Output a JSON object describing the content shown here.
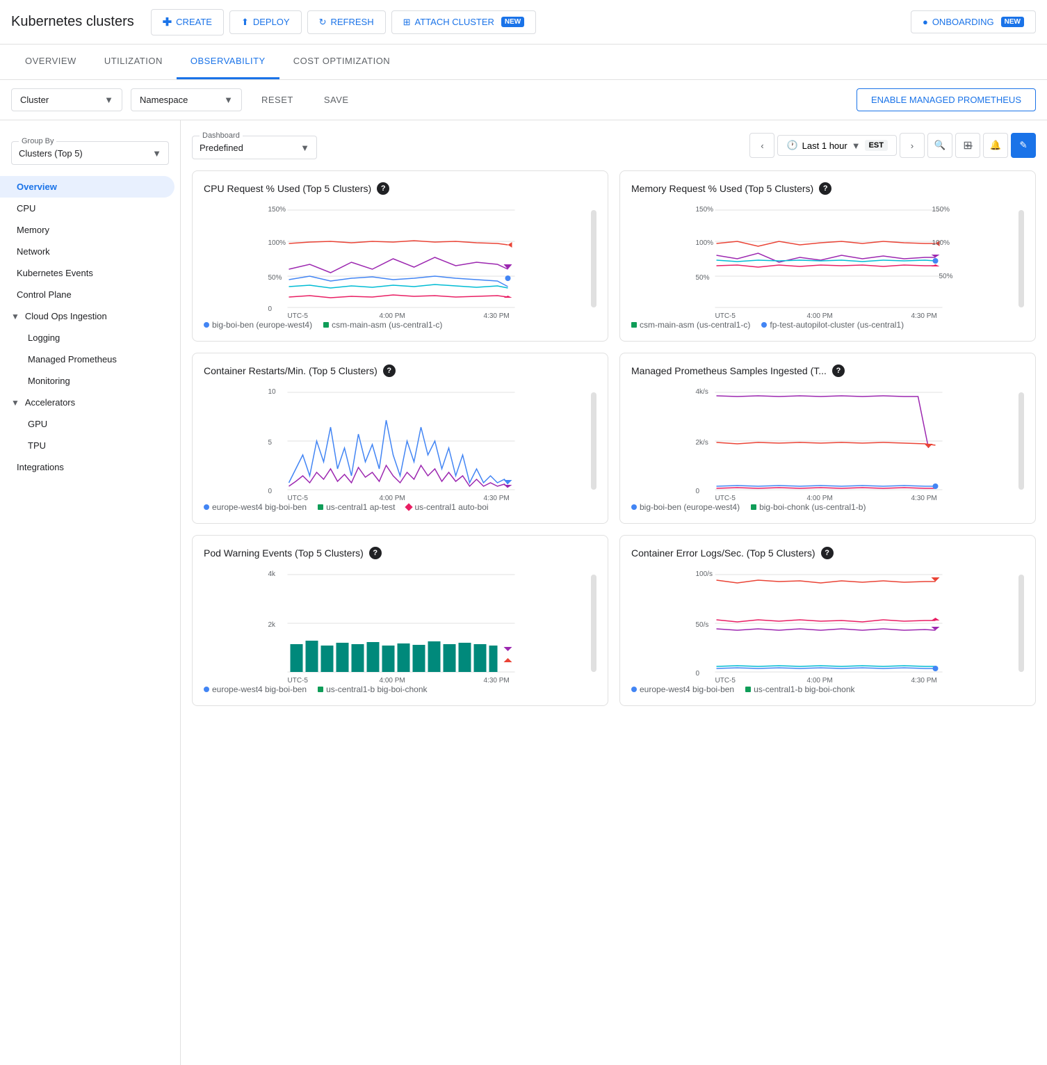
{
  "header": {
    "title": "Kubernetes clusters",
    "buttons": [
      {
        "id": "create",
        "label": "CREATE",
        "icon": "+"
      },
      {
        "id": "deploy",
        "label": "DEPLOY",
        "icon": "↑"
      },
      {
        "id": "refresh",
        "label": "REFRESH",
        "icon": "↻"
      },
      {
        "id": "attach",
        "label": "ATTACH CLUSTER",
        "icon": "⊞",
        "badge": "NEW"
      },
      {
        "id": "onboarding",
        "label": "ONBOARDING",
        "icon": "○",
        "badge": "NEW"
      }
    ]
  },
  "tabs": [
    {
      "id": "overview",
      "label": "OVERVIEW",
      "active": false
    },
    {
      "id": "utilization",
      "label": "UTILIZATION",
      "active": false
    },
    {
      "id": "observability",
      "label": "OBSERVABILITY",
      "active": true
    },
    {
      "id": "cost",
      "label": "COST OPTIMIZATION",
      "active": false
    }
  ],
  "filters": {
    "cluster_label": "Cluster",
    "namespace_label": "Namespace",
    "reset_label": "RESET",
    "save_label": "SAVE",
    "enable_btn": "ENABLE MANAGED PROMETHEUS"
  },
  "sidebar": {
    "group_by_label": "Group By",
    "group_by_value": "Clusters (Top 5)",
    "nav_items": [
      {
        "id": "overview",
        "label": "Overview",
        "active": true,
        "level": 1
      },
      {
        "id": "cpu",
        "label": "CPU",
        "active": false,
        "level": 1
      },
      {
        "id": "memory",
        "label": "Memory",
        "active": false,
        "level": 1
      },
      {
        "id": "network",
        "label": "Network",
        "active": false,
        "level": 1
      },
      {
        "id": "k8s-events",
        "label": "Kubernetes Events",
        "active": false,
        "level": 1
      },
      {
        "id": "control-plane",
        "label": "Control Plane",
        "active": false,
        "level": 1
      },
      {
        "id": "cloud-ops",
        "label": "Cloud Ops Ingestion",
        "active": false,
        "level": 0,
        "expandable": true,
        "expanded": true
      },
      {
        "id": "logging",
        "label": "Logging",
        "active": false,
        "level": 2
      },
      {
        "id": "managed-prometheus",
        "label": "Managed Prometheus",
        "active": false,
        "level": 2
      },
      {
        "id": "monitoring",
        "label": "Monitoring",
        "active": false,
        "level": 2
      },
      {
        "id": "accelerators",
        "label": "Accelerators",
        "active": false,
        "level": 0,
        "expandable": true,
        "expanded": true
      },
      {
        "id": "gpu",
        "label": "GPU",
        "active": false,
        "level": 2
      },
      {
        "id": "tpu",
        "label": "TPU",
        "active": false,
        "level": 2
      },
      {
        "id": "integrations",
        "label": "Integrations",
        "active": false,
        "level": 1
      }
    ]
  },
  "dashboard": {
    "label": "Dashboard",
    "predefined_label": "Predefined",
    "time_label": "Last 1 hour",
    "time_badge": "EST",
    "charts": [
      {
        "id": "cpu-request",
        "title": "CPU Request % Used (Top 5 Clusters)",
        "y_max": "150%",
        "y_mid": "100%",
        "y_low": "50%",
        "y_zero": "0",
        "x_labels": [
          "UTC-5",
          "4:00 PM",
          "4:30 PM"
        ],
        "legend": [
          {
            "color": "#4285f4",
            "shape": "dot",
            "label": "big-boi-ben (europe-west4)"
          },
          {
            "color": "#0f9d58",
            "shape": "square",
            "label": "csm-main-asm (us-central1-c)"
          }
        ]
      },
      {
        "id": "memory-request",
        "title": "Memory Request % Used (Top 5 Clusters)",
        "y_max": "150%",
        "y_mid": "100%",
        "y_low": "50%",
        "x_labels": [
          "UTC-5",
          "4:00 PM",
          "4:30 PM"
        ],
        "legend": [
          {
            "color": "#0f9d58",
            "shape": "square",
            "label": "csm-main-asm (us-central1-c)"
          },
          {
            "color": "#4285f4",
            "shape": "dot",
            "label": "fp-test-autopilot-cluster (us-central1)"
          }
        ]
      },
      {
        "id": "container-restarts",
        "title": "Container Restarts/Min. (Top 5 Clusters)",
        "y_max": "10",
        "y_mid": "5",
        "y_zero": "0",
        "x_labels": [
          "UTC-5",
          "4:00 PM",
          "4:30 PM"
        ],
        "legend": [
          {
            "color": "#4285f4",
            "shape": "dot",
            "label": "europe-west4 big-boi-ben"
          },
          {
            "color": "#0f9d58",
            "shape": "square",
            "label": "us-central1 ap-test"
          },
          {
            "color": "#e91e63",
            "shape": "diamond",
            "label": "us-central1 auto-boi"
          }
        ]
      },
      {
        "id": "managed-prometheus",
        "title": "Managed Prometheus Samples Ingested (T...",
        "y_max": "4k/s",
        "y_mid": "2k/s",
        "y_zero": "0",
        "x_labels": [
          "UTC-5",
          "4:00 PM",
          "4:30 PM"
        ],
        "legend": [
          {
            "color": "#4285f4",
            "shape": "dot",
            "label": "big-boi-ben (europe-west4)"
          },
          {
            "color": "#0f9d58",
            "shape": "square",
            "label": "big-boi-chonk (us-central1-b)"
          }
        ]
      },
      {
        "id": "pod-warnings",
        "title": "Pod Warning Events (Top 5 Clusters)",
        "y_max": "4k",
        "y_mid": "2k",
        "x_labels": [
          "UTC-5",
          "4:00 PM",
          "4:30 PM"
        ],
        "legend": [
          {
            "color": "#4285f4",
            "shape": "dot",
            "label": "europe-west4 big-boi-ben"
          },
          {
            "color": "#0f9d58",
            "shape": "square",
            "label": "us-central1-b big-boi-chonk"
          }
        ]
      },
      {
        "id": "container-error-logs",
        "title": "Container Error Logs/Sec. (Top 5 Clusters)",
        "y_max": "100/s",
        "y_mid": "50/s",
        "y_zero": "0",
        "x_labels": [
          "UTC-5",
          "4:00 PM",
          "4:30 PM"
        ],
        "legend": [
          {
            "color": "#4285f4",
            "shape": "dot",
            "label": "europe-west4 big-boi-ben"
          },
          {
            "color": "#0f9d58",
            "shape": "square",
            "label": "us-central1-b big-boi-chonk"
          }
        ]
      }
    ]
  }
}
